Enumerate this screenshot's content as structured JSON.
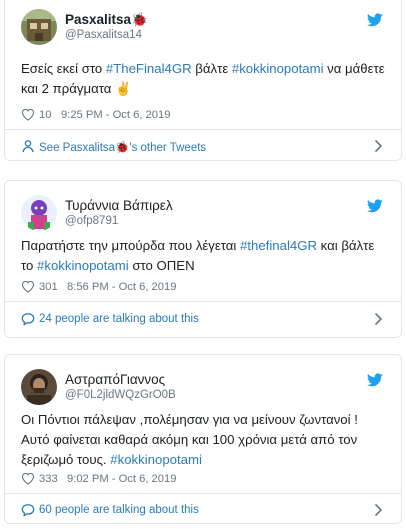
{
  "tweets": [
    {
      "display_name": "Pasxalitsa🐞",
      "handle": "@Pasxalitsa14",
      "text": [
        {
          "t": "Εσείς εκεί στο ",
          "tag": false
        },
        {
          "t": "#TheFinal4GR",
          "tag": true
        },
        {
          "t": " βάλτε ",
          "tag": false
        },
        {
          "t": "#kokkinopotami",
          "tag": true
        },
        {
          "t": " να μάθετε και 2 πράγματα ✌️",
          "tag": false
        }
      ],
      "likes": "10",
      "time": "9:25 PM - Oct 6, 2019",
      "footer": "See Pasxalitsa🐞's other Tweets",
      "footer_icon": "person-icon"
    },
    {
      "display_name": "Τυράννια Βάπιρελ",
      "handle": "@ofp8791",
      "text": [
        {
          "t": "Παρατήστε την μπούρδα που λέγεται ",
          "tag": false
        },
        {
          "t": "#thefinal4GR",
          "tag": true
        },
        {
          "t": " και βάλτε το ",
          "tag": false
        },
        {
          "t": "#kokkinopotami",
          "tag": true
        },
        {
          "t": " στο ΟΠΕΝ",
          "tag": false
        }
      ],
      "likes": "301",
      "time": "8:56 PM - Oct 6, 2019",
      "footer": "24 people are talking about this",
      "footer_icon": "comment-icon"
    },
    {
      "display_name": "ΑστραπόΓιαννος",
      "handle": "@F0L2jldWQzGrO0B",
      "text": [
        {
          "t": "Οι Πόντιοι πάλεψαν ,πολέμησαν για να μείνουν ζωντανοί ! Αυτό φαίνεται καθαρά ακόμη και 100 χρόνια μετά από τον ξεριζωμό τους. ",
          "tag": false
        },
        {
          "t": "#kokkinopotami",
          "tag": true
        }
      ],
      "likes": "333",
      "time": "9:02 PM - Oct 6, 2019",
      "footer": "60 people are talking about this",
      "footer_icon": "comment-icon"
    }
  ],
  "colors": {
    "link": "#2b7bb9",
    "meta": "#697882",
    "border": "#e1e8ed",
    "bird": "#1da1f2"
  }
}
